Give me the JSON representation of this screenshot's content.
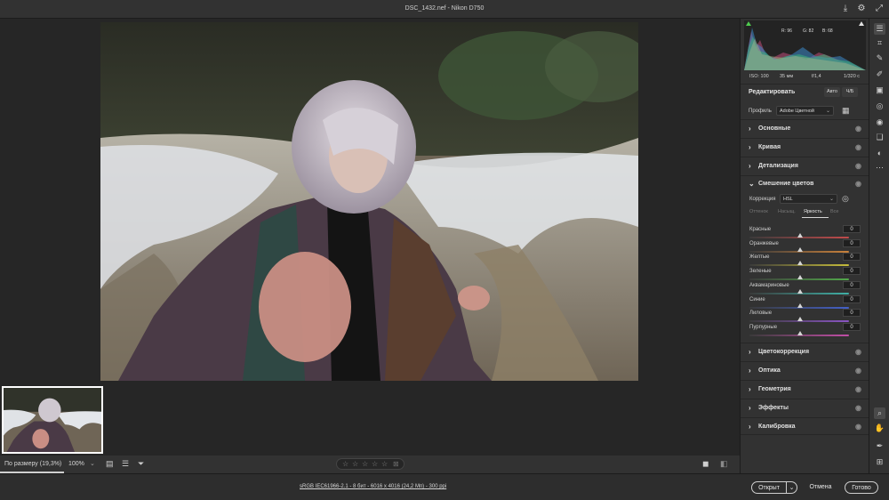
{
  "window": {
    "title": "DSC_1432.nef  -  Nikon D750"
  },
  "histogram": {
    "r": "R: 96",
    "g": "G: 82",
    "b": "B: 68"
  },
  "exif": {
    "iso": "ISO: 100",
    "focal": "35 мм",
    "aperture": "f/1,4",
    "shutter": "1/320 с"
  },
  "edit": {
    "title": "Редактировать",
    "auto": "Авто",
    "bw": "Ч/Б"
  },
  "profile": {
    "label": "Профиль",
    "value": "Adobe Цветной"
  },
  "sections_top": [
    "Основные",
    "Кривая",
    "Детализация"
  ],
  "hsl": {
    "title": "Смешение цветов",
    "correction_label": "Коррекция",
    "correction_value": "HSL",
    "tabs": [
      "Оттенок",
      "Насыщ.",
      "Яркость",
      "Все"
    ],
    "active_tab": "Яркость",
    "sliders": [
      {
        "name": "Красные",
        "value": "0",
        "color": "#c24b4b"
      },
      {
        "name": "Оранжевые",
        "value": "0",
        "color": "#c9813a"
      },
      {
        "name": "Желтые",
        "value": "0",
        "color": "#c6bc3b"
      },
      {
        "name": "Зеленые",
        "value": "0",
        "color": "#52a84a"
      },
      {
        "name": "Аквамариновые",
        "value": "0",
        "color": "#3fb0a6"
      },
      {
        "name": "Синие",
        "value": "0",
        "color": "#4360c8"
      },
      {
        "name": "Лиловые",
        "value": "0",
        "color": "#8a55c4"
      },
      {
        "name": "Пурпурные",
        "value": "0",
        "color": "#c24ea7"
      }
    ]
  },
  "sections_bottom": [
    "Цветокоррекция",
    "Оптика",
    "Геометрия",
    "Эффекты",
    "Калибровка"
  ],
  "bottombar": {
    "fit": "По размеру (19,3%)",
    "zoom": "100%"
  },
  "status": {
    "info": "sRGB IEC61966-2.1 - 8 бит - 6016 x 4016 (24,2 Мп) - 300 ppi"
  },
  "buttons": {
    "open": "Открыт",
    "cancel": "Отмена",
    "done": "Готово"
  },
  "colors": {
    "accent": "#1473e6",
    "panel": "#323232",
    "background": "#262626"
  }
}
